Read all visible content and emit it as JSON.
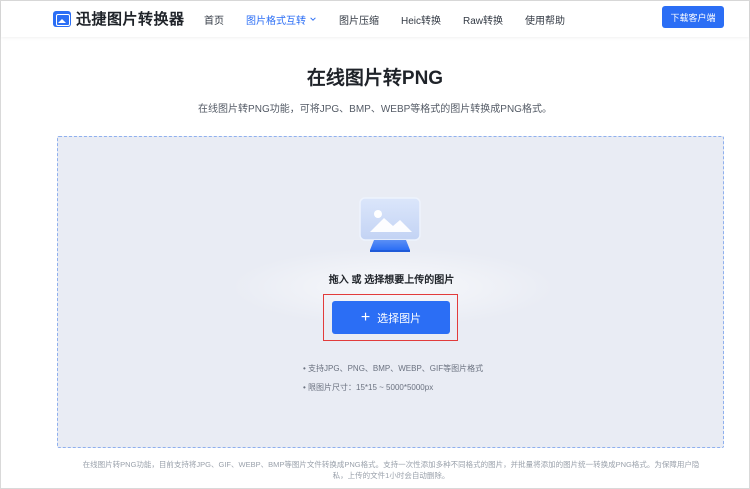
{
  "header": {
    "brand": "迅捷图片转换器",
    "nav": [
      {
        "label": "首页",
        "active": false
      },
      {
        "label": "图片格式互转",
        "active": true
      },
      {
        "label": "图片压缩",
        "active": false
      },
      {
        "label": "Heic转换",
        "active": false
      },
      {
        "label": "Raw转换",
        "active": false
      },
      {
        "label": "使用帮助",
        "active": false
      }
    ],
    "download_label": "下载客户端"
  },
  "hero": {
    "title": "在线图片转PNG",
    "subtitle": "在线图片转PNG功能，可将JPG、BMP、WEBP等格式的图片转换成PNG格式。"
  },
  "upload": {
    "hint": "拖入 或 选择想要上传的图片",
    "button_label": "选择图片",
    "rules": [
      "• 支持JPG、PNG、BMP、WEBP、GIF等图片格式",
      "• 限图片尺寸：15*15 ~ 5000*5000px"
    ]
  },
  "footer": {
    "text": "在线图片转PNG功能，目前支持将JPG、GIF、WEBP、BMP等图片文件转换成PNG格式。支持一次性添加多种不同格式的图片，并批量将添加的图片统一转换成PNG格式。为保障用户隐私，上传的文件1小时会自动删除。"
  },
  "colors": {
    "accent": "#2b6ef5",
    "highlight": "#e23b3b",
    "dropzone_bg": "#e9ecf4"
  }
}
